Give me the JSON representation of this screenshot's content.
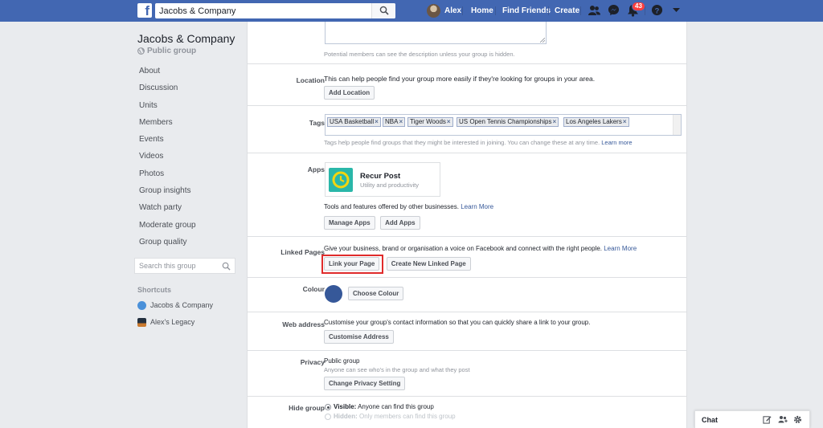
{
  "topbar": {
    "search_value": "Jacobs & Company",
    "profile_name": "Alex",
    "home": "Home",
    "find_friends": "Find Friends",
    "create": "Create",
    "notification_count": "43"
  },
  "sidebar": {
    "group_name": "Jacobs & Company",
    "group_type": "Public group",
    "items": [
      {
        "label": "About"
      },
      {
        "label": "Discussion"
      },
      {
        "label": "Units"
      },
      {
        "label": "Members"
      },
      {
        "label": "Events"
      },
      {
        "label": "Videos"
      },
      {
        "label": "Photos"
      },
      {
        "label": "Group insights"
      },
      {
        "label": "Watch party"
      },
      {
        "label": "Moderate group"
      },
      {
        "label": "Group quality"
      }
    ],
    "search_placeholder": "Search this group",
    "shortcuts_title": "Shortcuts",
    "shortcuts": [
      {
        "label": "Jacobs & Company"
      },
      {
        "label": "Alex's Legacy"
      }
    ]
  },
  "settings": {
    "description_hint": "Potential members can see the description unless your group is hidden.",
    "location": {
      "label": "Location",
      "text": "This can help people find your group more easily if they're looking for groups in your area.",
      "button": "Add Location"
    },
    "tags": {
      "label": "Tags",
      "items": [
        "USA Basketball",
        "NBA",
        "Tiger Woods",
        "US Open Tennis Championships",
        "Los Angeles Lakers"
      ],
      "hint": "Tags help people find groups that they might be interested in joining. You can change these at any time.",
      "learn_more": "Learn more"
    },
    "apps": {
      "label": "Apps",
      "app_name": "Recur Post",
      "app_category": "Utility and productivity",
      "hint": "Tools and features offered by other businesses.",
      "learn_more": "Learn More",
      "manage_button": "Manage Apps",
      "add_button": "Add Apps"
    },
    "linked_pages": {
      "label": "Linked Pages",
      "text": "Give your business, brand or organisation a voice on Facebook and connect with the right people.",
      "learn_more": "Learn More",
      "link_button": "Link your Page",
      "create_button": "Create New Linked Page"
    },
    "colour": {
      "label": "Colour",
      "swatch_color": "#365899",
      "button": "Choose Colour"
    },
    "web_address": {
      "label": "Web address",
      "text": "Customise your group's contact information so that you can quickly share a link to your group.",
      "button": "Customise Address"
    },
    "privacy": {
      "label": "Privacy",
      "value": "Public group",
      "hint": "Anyone can see who's in the group and what they post",
      "button": "Change Privacy Setting"
    },
    "hide_group": {
      "label": "Hide group",
      "visible_title": "Visible:",
      "visible_text": "Anyone can find this group",
      "hidden_title": "Hidden:",
      "hidden_text": "Only members can find this group"
    }
  },
  "chat": {
    "label": "Chat"
  },
  "colors": {
    "topbar": "#4267b2",
    "highlight": "#e02b2b"
  }
}
